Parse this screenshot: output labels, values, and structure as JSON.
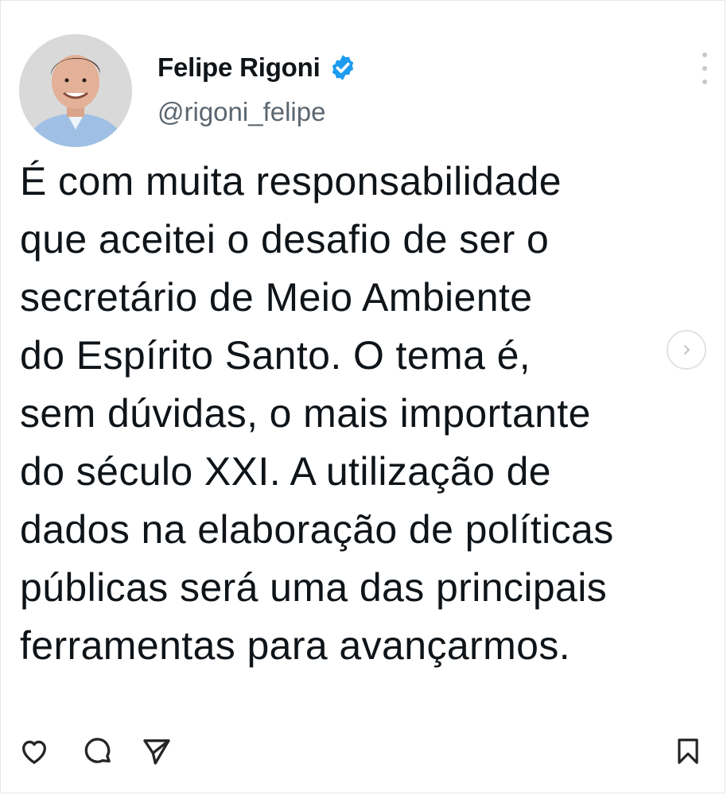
{
  "post": {
    "author_name": "Felipe Rigoni",
    "author_handle": "@rigoni_felipe",
    "verified_icon": "verified-badge-icon",
    "text_lines": [
      "É com muita responsabilidade",
      "que aceitei o desafio de ser o",
      "secretário de Meio Ambiente",
      "do Espírito Santo. O tema é,",
      "sem dúvidas, o mais importante",
      "do século XXI. A utilização de",
      "dados na elaboração de políticas",
      "públicas será uma das principais",
      "ferramentas para avançarmos."
    ]
  },
  "actions": {
    "like_icon": "heart-icon",
    "comment_icon": "comment-icon",
    "share_icon": "send-icon",
    "save_icon": "bookmark-icon"
  },
  "colors": {
    "verified_blue": "#1d9bf0",
    "text": "#0f1419",
    "muted": "#5b6670"
  }
}
